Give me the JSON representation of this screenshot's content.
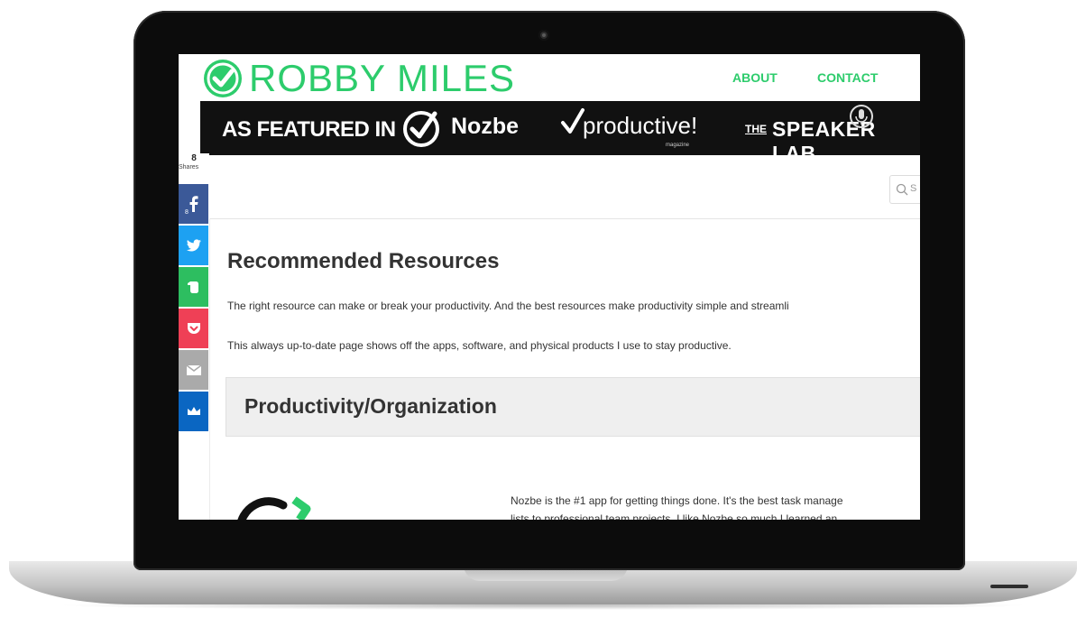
{
  "header": {
    "logo_text": "ROBBY MILES",
    "nav": {
      "about": "ABOUT",
      "contact": "CONTACT"
    },
    "accent_color": "#2dcc6c"
  },
  "banner": {
    "featured_label": "AS FEATURED IN",
    "nozbe": "Nozbe",
    "productive": "productive!",
    "productive_sub": "magazine",
    "speaker_the": "THE",
    "speaker_lab": "SPEAKER LAB"
  },
  "share": {
    "count": "8",
    "label": "Shares",
    "facebook_count": "8",
    "buttons": [
      {
        "icon": "facebook-icon",
        "color": "#3b5998"
      },
      {
        "icon": "twitter-icon",
        "color": "#1da1f2"
      },
      {
        "icon": "evernote-icon",
        "color": "#2dbe60"
      },
      {
        "icon": "pocket-icon",
        "color": "#ef4056"
      },
      {
        "icon": "email-icon",
        "color": "#aaaaaa"
      },
      {
        "icon": "crown-icon",
        "color": "#0a66c2"
      }
    ]
  },
  "search": {
    "placeholder": "S"
  },
  "main": {
    "title": "Recommended Resources",
    "intro": "The right resource can make or break your productivity. And the best resources make productivity simple and streamli",
    "intro2": "This always up-to-date page shows off the apps, software, and physical products I use to stay productive.",
    "section_title": "Productivity/Organization",
    "nozbe_text": "Nozbe is the #1 app for getting things done. It's the best task manage",
    "nozbe_text2": "lists to professional team projects. I like Nozbe so much I learned an"
  }
}
